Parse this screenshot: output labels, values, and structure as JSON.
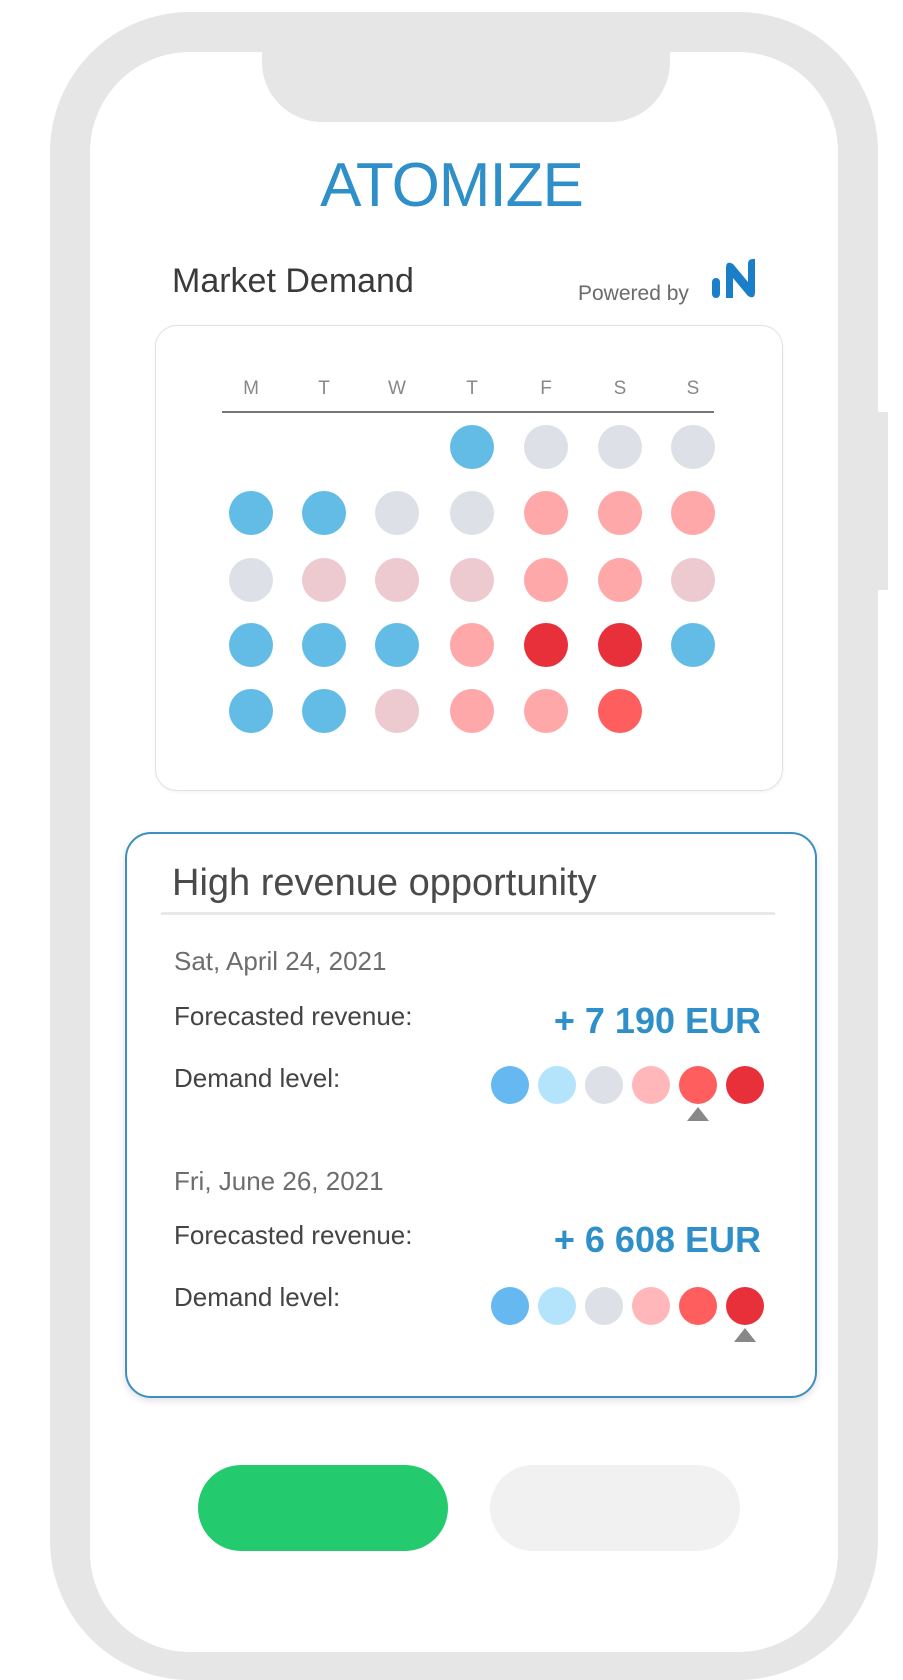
{
  "brand": {
    "logo_text": "ATOMIZE",
    "accent_color": "#2f8fc8"
  },
  "market_demand": {
    "title": "Market Demand",
    "powered_by": "Powered by",
    "provider_icon": "n-logo-icon",
    "weekdays": [
      "M",
      "T",
      "W",
      "T",
      "F",
      "S",
      "S"
    ],
    "demand_colors": {
      "low": "#62bce6",
      "below_average": "#dde0e6",
      "average": "#edcacf",
      "elevated": "#fea8a9",
      "high": "#fe5e5e",
      "very_high": "#e8303a"
    },
    "calendar_rows": [
      [
        null,
        null,
        null,
        "low",
        "below_average",
        "below_average",
        "below_average"
      ],
      [
        "low",
        "low",
        "below_average",
        "below_average",
        "elevated",
        "elevated",
        "elevated"
      ],
      [
        "below_average",
        "average",
        "average",
        "average",
        "elevated",
        "elevated",
        "average"
      ],
      [
        "low",
        "low",
        "low",
        "elevated",
        "very_high",
        "very_high",
        "low"
      ],
      [
        "low",
        "low",
        "average",
        "elevated",
        "elevated",
        "high",
        null
      ]
    ]
  },
  "revenue": {
    "title": "High revenue opportunity",
    "scale_colors": [
      "#65b8f0",
      "#b3e4fc",
      "#dde0e6",
      "#ffb7b9",
      "#fe5e5e",
      "#e8303a"
    ],
    "entries": [
      {
        "date": "Sat, April 24, 2021",
        "revenue_label": "Forecasted revenue:",
        "revenue_value": "+ 7 190 EUR",
        "demand_label": "Demand level:",
        "demand_level": 5
      },
      {
        "date": "Fri, June 26, 2021",
        "revenue_label": "Forecasted revenue:",
        "revenue_value": "+ 6 608 EUR",
        "demand_label": "Demand level:",
        "demand_level": 6
      }
    ]
  },
  "actions": {
    "primary_color": "#24cb6e",
    "secondary_color": "#f1f1f1"
  }
}
